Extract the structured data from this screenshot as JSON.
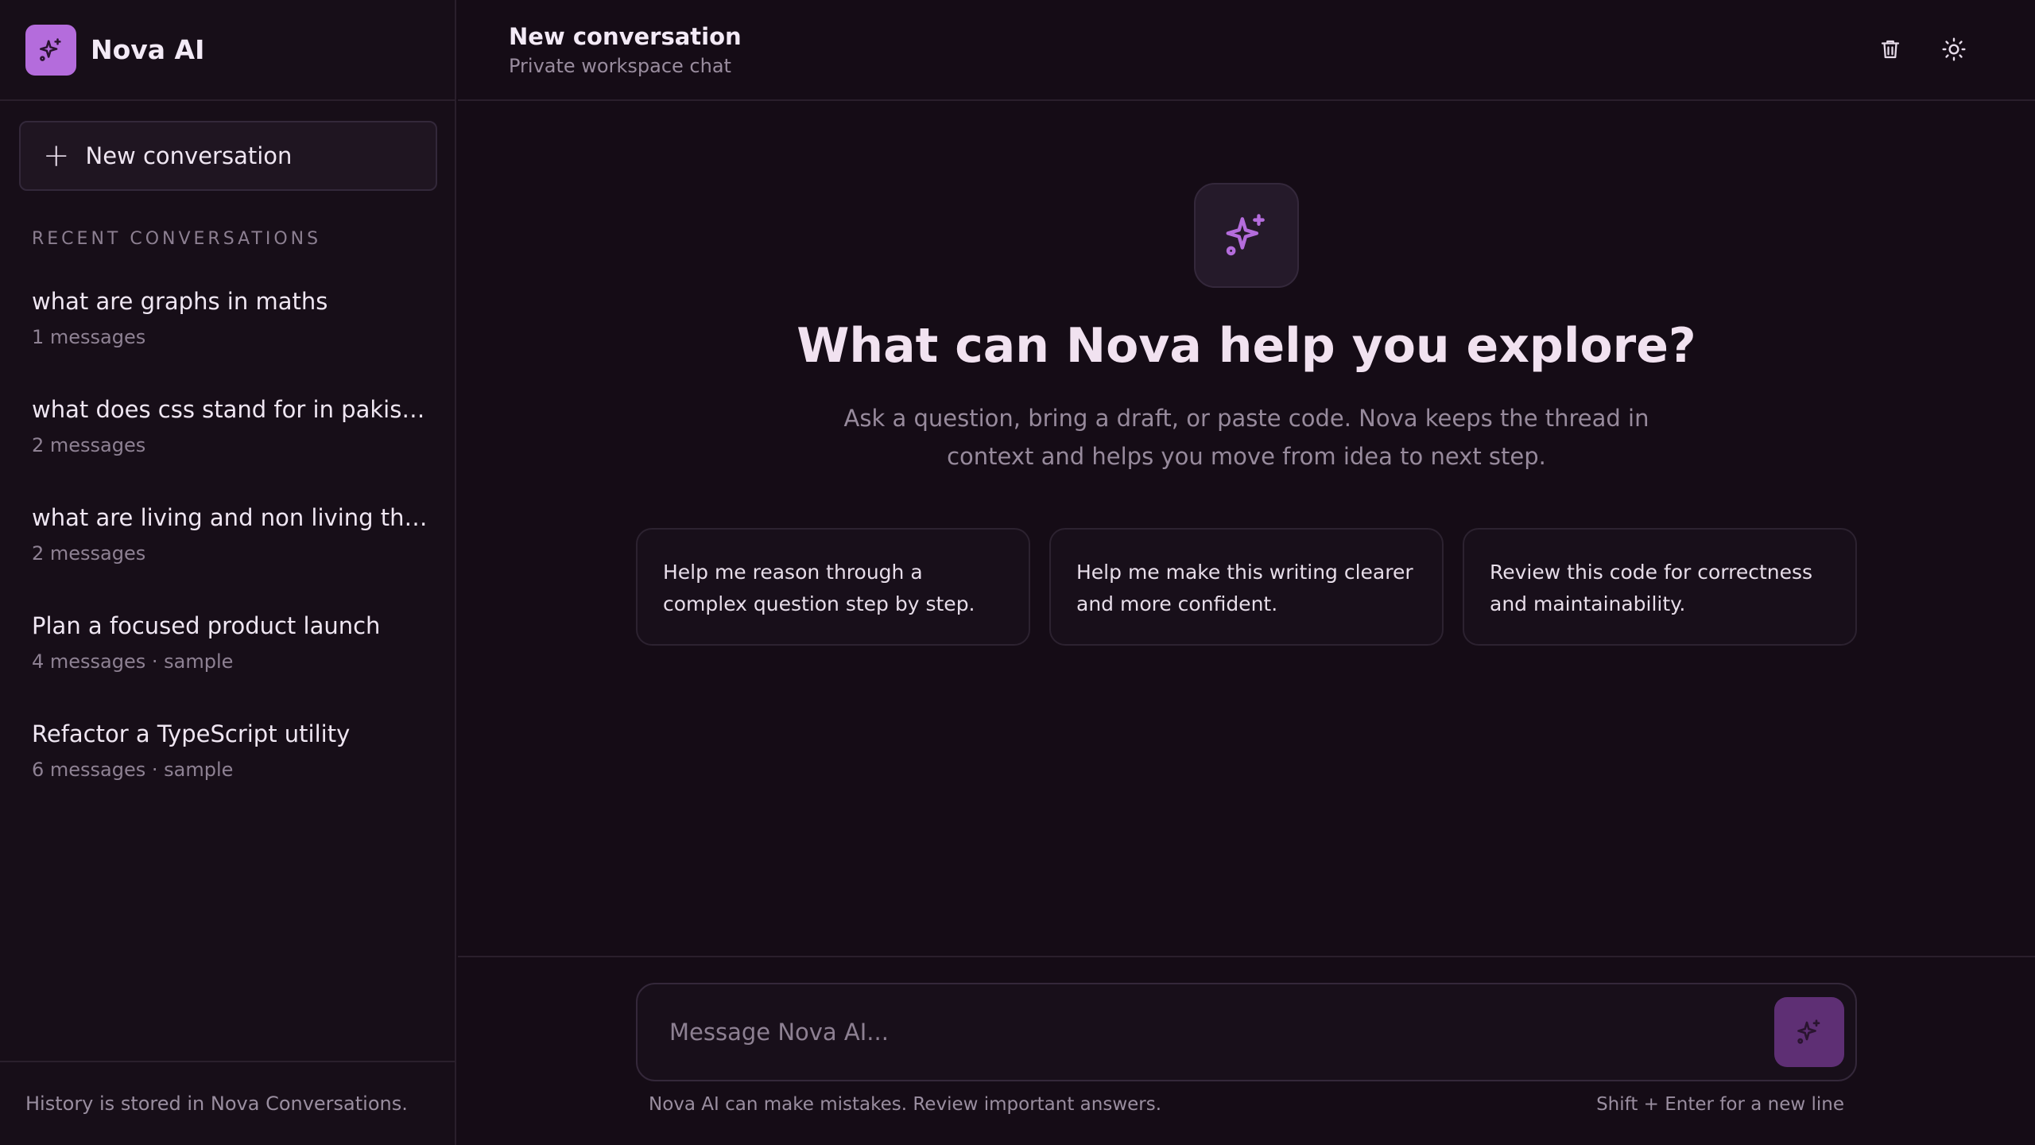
{
  "app": {
    "name": "Nova AI",
    "accent": "#b46cdc",
    "background": "#150c16"
  },
  "sidebar": {
    "new_button": "New conversation",
    "recent_label": "RECENT CONVERSATIONS",
    "conversations": [
      {
        "title": "what are graphs in maths",
        "meta": "1 messages"
      },
      {
        "title": "what does css stand for in pakistan",
        "meta": "2 messages"
      },
      {
        "title": "what are living and non living things",
        "meta": "2 messages"
      },
      {
        "title": "Plan a focused product launch",
        "meta": "4 messages · sample"
      },
      {
        "title": "Refactor a TypeScript utility",
        "meta": "6 messages · sample"
      }
    ],
    "footer": "History is stored in Nova Conversations."
  },
  "header": {
    "title": "New conversation",
    "subtitle": "Private workspace chat",
    "icons": [
      "trash-icon",
      "sun-icon"
    ]
  },
  "hero": {
    "title": "What can Nova help you explore?",
    "description": "Ask a question, bring a draft, or paste code. Nova keeps the thread in context and helps you move from idea to next step."
  },
  "suggestions": [
    "Help me reason through a complex question step by step.",
    "Help me make this writing clearer and more confident.",
    "Review this code for correctness and maintainability."
  ],
  "composer": {
    "placeholder": "Message Nova AI...",
    "disclaimer": "Nova AI can make mistakes. Review important answers.",
    "hint": "Shift + Enter for a new line"
  }
}
